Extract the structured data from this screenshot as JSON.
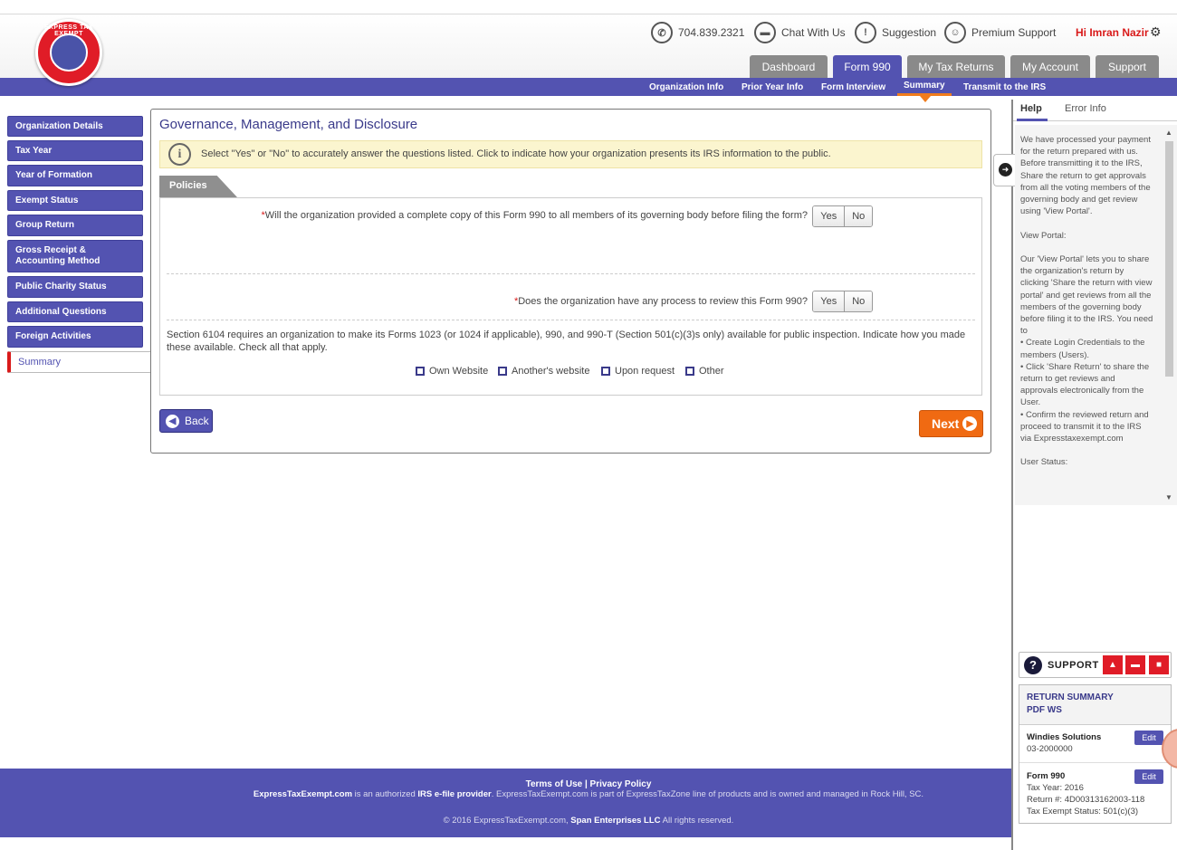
{
  "logo": {
    "text": "EXPRESS TAX EXEMPT"
  },
  "header": {
    "phone": "704.839.2321",
    "chat": "Chat With Us",
    "suggestion": "Suggestion",
    "premium": "Premium Support",
    "user": "Hi Imran Nazir"
  },
  "main_tabs": [
    "Dashboard",
    "Form 990",
    "My Tax Returns",
    "My Account",
    "Support"
  ],
  "sub_tabs": [
    "Organization Info",
    "Prior Year Info",
    "Form Interview",
    "Summary",
    "Transmit to the IRS"
  ],
  "sidebar": [
    "Organization Details",
    "Tax Year",
    "Year of Formation",
    "Exempt Status",
    "Group Return",
    "Gross Receipt & Accounting Method",
    "Public Charity Status",
    "Additional Questions",
    "Foreign Activities",
    "Summary"
  ],
  "page": {
    "title": "Governance, Management, and Disclosure",
    "info": "Select \"Yes\" or \"No\" to accurately answer the questions listed. Click to indicate how your organization presents its IRS information to the public.",
    "section_tab": "Policies",
    "q1": "Will the organization provided a complete copy of this Form 990 to all members of its governing body before filing the form?",
    "q2": "Does the organization have any process to review this Form 990?",
    "yes": "Yes",
    "no": "No",
    "section_text": "Section 6104 requires an organization to make its Forms 1023 (or 1024 if applicable), 990, and 990-T (Section 501(c)(3)s only) available for public inspection. Indicate how you made these available. Check all that apply.",
    "checkboxes": [
      "Own Website",
      "Another's website",
      "Upon request",
      "Other"
    ],
    "back": "Back",
    "next": "Next"
  },
  "help": {
    "tab_help": "Help",
    "tab_error": "Error Info",
    "text": "We have processed your payment for the return prepared with us. Before transmitting it to the IRS, Share the return to get approvals from all the voting members of the governing body and get review using 'View Portal'.\n\nView Portal:\n\nOur 'View Portal' lets you to share the organization's return by clicking 'Share the return with view portal' and get reviews from all the members of the governing body before filing it to the IRS. You need to\n•     Create Login Credentials to the members (Users).\n•     Click 'Share Return' to share the return to get reviews and approvals electronically from the User.\n•     Confirm the reviewed return and proceed to transmit it to the IRS via Expresstaxexempt.com\n\nUser Status:"
  },
  "support": {
    "label": "SUPPORT"
  },
  "return_summary": {
    "title": "RETURN SUMMARY",
    "links": "PDF  WS",
    "org_name": "Windies Solutions",
    "ein": "03-2000000",
    "form": "Form 990",
    "tax_year": "Tax Year: 2016",
    "return_no": "Return #: 4D00313162003-118",
    "status": "Tax Exempt Status: 501(c)(3)",
    "edit": "Edit"
  },
  "footer": {
    "links": "Terms of Use | Privacy Policy",
    "brand": "ExpressTaxExempt.com",
    "line_a": " is an authorized ",
    "irs": "IRS e-file provider",
    "line_b": ". ExpressTaxExempt.com is part of ExpressTaxZone line of products and is owned and managed in Rock Hill, SC.",
    "copy_a": "© 2016 ExpressTaxExempt.com, ",
    "company": "Span Enterprises LLC",
    "copy_b": " All rights reserved."
  }
}
